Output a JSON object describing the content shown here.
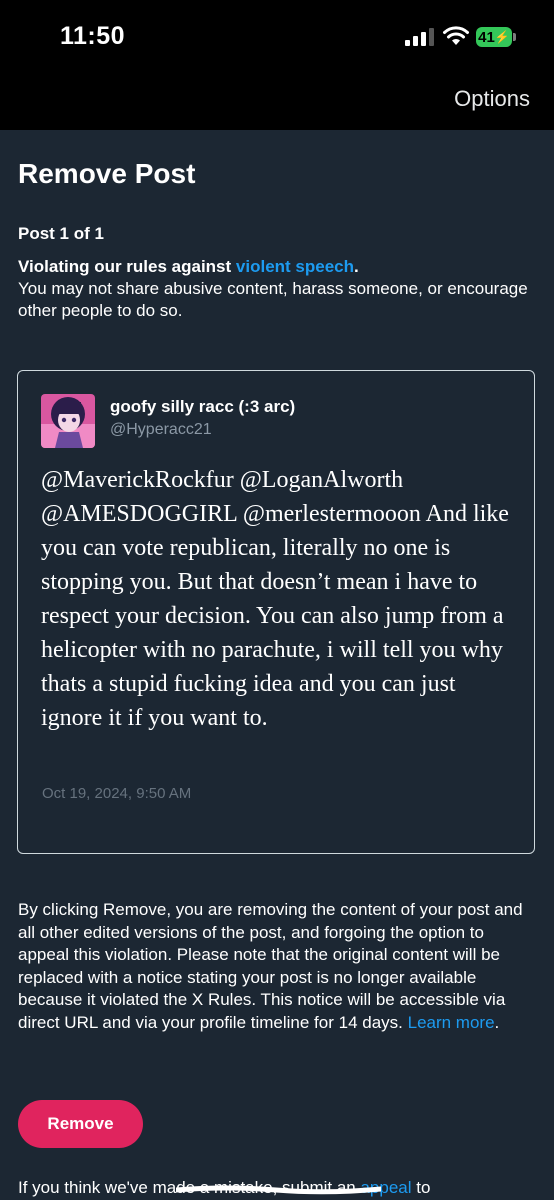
{
  "status_bar": {
    "time": "11:50",
    "battery": "41",
    "icons": [
      "cellular-signal-icon",
      "wifi-icon",
      "battery-charging-icon"
    ]
  },
  "nav": {
    "options_label": "Options"
  },
  "page": {
    "title": "Remove Post",
    "counter": "Post 1 of 1",
    "violation_prefix": "Violating our rules against ",
    "violation_link": "violent speech",
    "violation_suffix": ".",
    "violation_description": "You may not share abusive content, harass someone, or encourage other people to do so."
  },
  "post": {
    "display_name": "goofy silly racc (:3 arc)",
    "handle": "@Hyperacc21",
    "text": "@MaverickRockfur @LoganAlworth @AMESDOGGIRL @merlestermooon And like you can vote republican, literally no one is stopping you. But that doesn’t mean i have to respect your decision. You can also jump from a helicopter with no parachute, i will tell you why thats a stupid fucking idea and you can just ignore it if you want to.",
    "timestamp": "Oct 19, 2024, 9:50 AM"
  },
  "disclaimer": {
    "text": "By clicking Remove, you are removing the content of your post and all other edited versions of the post, and forgoing the option to appeal this violation. Please note that the original content will be replaced with a notice stating your post is no longer available because it violated the X Rules. This notice will be accessible via direct URL and via your profile timeline for 14 days. ",
    "learn_more": "Learn more",
    "end": "."
  },
  "actions": {
    "remove_label": "Remove"
  },
  "footer": {
    "prefix": "If you think we've made a mistake, submit an ",
    "appeal_link": "appeal",
    "suffix": " to"
  },
  "colors": {
    "background": "#1c2733",
    "link": "#1d9bf0",
    "remove_button": "#e0245e",
    "battery": "#34c759"
  }
}
